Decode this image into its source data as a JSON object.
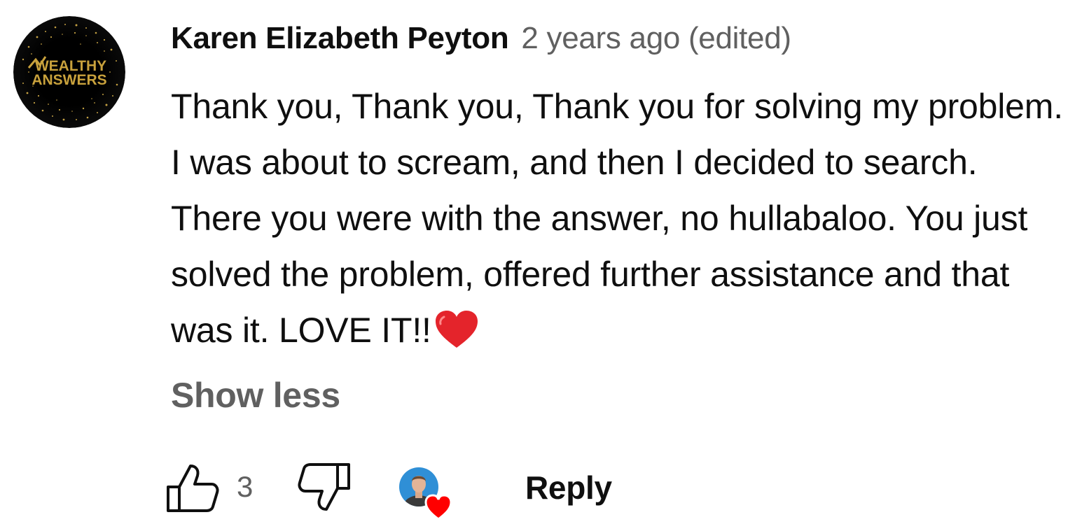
{
  "comment": {
    "avatar": {
      "logo_line1": "WEALTHY",
      "logo_line2": "ANSWERS"
    },
    "author": "Karen Elizabeth Peyton",
    "meta": "2 years ago (edited)",
    "text": "Thank you, Thank you, Thank you for solving my problem. I was about to scream, and then I decided to search. There you were with the answer, no hullabaloo. You just solved the problem, offered further assistance and that was it. LOVE IT!!",
    "text_emoji": "red-heart-emoji",
    "show_less_label": "Show less",
    "actions": {
      "like_icon": "thumb-up-icon",
      "like_count": "3",
      "dislike_icon": "thumb-down-icon",
      "creator_heart_icon": "creator-heart-icon",
      "reply_label": "Reply"
    },
    "colors": {
      "primary_text": "#0f0f0f",
      "secondary_text": "#606060",
      "heart_red": "#ff0000",
      "avatar_bg": "#000000",
      "logo_gold": "#c8a13c"
    }
  }
}
